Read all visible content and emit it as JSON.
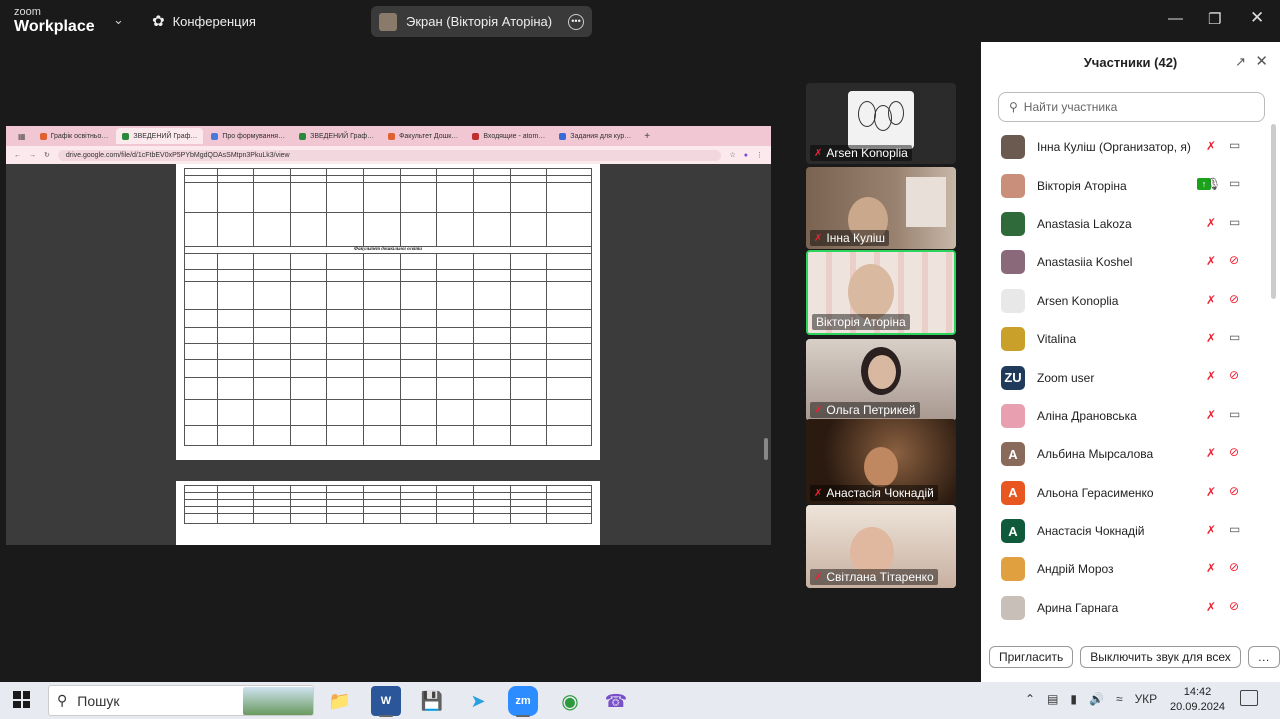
{
  "app": {
    "logo_top": "zoom",
    "logo_bottom": "Workplace",
    "meeting_label": "Конференция",
    "share_label": "Экран (Вікторія Аторіна)"
  },
  "browser": {
    "tabs": [
      "Графік освітньо…",
      "ЗВЕДЕНИЙ Граф…",
      "Про формування…",
      "ЗВЕДЕНИЙ Граф…",
      "Факультет Дошк…",
      "Входящие - atom…",
      "Задания для кур…"
    ],
    "url": "drive.google.com/file/d/1cFtbEV0xP5PYbMgdQDAsSMtpn3PkuLk3/view",
    "doc_section_heading": "Факультет дошкільної освіти"
  },
  "video_tiles": [
    {
      "name": "Arsen Konoplia"
    },
    {
      "name": "Інна Куліш"
    },
    {
      "name": "Вікторія Аторіна"
    },
    {
      "name": "Ольга Петрикей"
    },
    {
      "name": "Анастасія Чокнадій"
    },
    {
      "name": "Світлана Тітаренко"
    }
  ],
  "participants_panel": {
    "title": "Участники (42)",
    "search_placeholder": "Найти участника",
    "participants": [
      {
        "name": "Інна Куліш (Организатор, я)",
        "avatar": "photo",
        "color": "#6b5a4f"
      },
      {
        "name": "Вікторія Аторіна",
        "avatar": "photo",
        "color": "#c98f7a"
      },
      {
        "name": "Anastasia Lakoza",
        "avatar": "photo",
        "color": "#2f6b3a"
      },
      {
        "name": "Anastasiia Koshel",
        "avatar": "photo",
        "color": "#8a6a7a"
      },
      {
        "name": "Arsen Konoplia",
        "avatar": "photo",
        "color": "#e8e8e8"
      },
      {
        "name": "Vitalina",
        "avatar": "photo",
        "color": "#c9a02a"
      },
      {
        "name": "Zoom user",
        "avatar": "ZU",
        "color": "#1f3a5a"
      },
      {
        "name": "Аліна Драновська",
        "avatar": "photo",
        "color": "#e8a0b0"
      },
      {
        "name": "Альбина Мырсалова",
        "avatar": "А",
        "color": "#8a6a5a"
      },
      {
        "name": "Альона Герасименко",
        "avatar": "А",
        "color": "#e8571f"
      },
      {
        "name": "Анастасія Чокнадій",
        "avatar": "А",
        "color": "#0f5a3a"
      },
      {
        "name": "Андрій Мороз",
        "avatar": "photo",
        "color": "#e0a040"
      },
      {
        "name": "Арина Гарнага",
        "avatar": "photo",
        "color": "#c8c0b8"
      }
    ],
    "invite_button": "Пригласить",
    "mute_all_button": "Выключить звук для всех",
    "more_button": "…"
  },
  "taskbar": {
    "search_label": "Пошук",
    "lang": "УКР",
    "time": "14:42",
    "date": "20.09.2024"
  }
}
